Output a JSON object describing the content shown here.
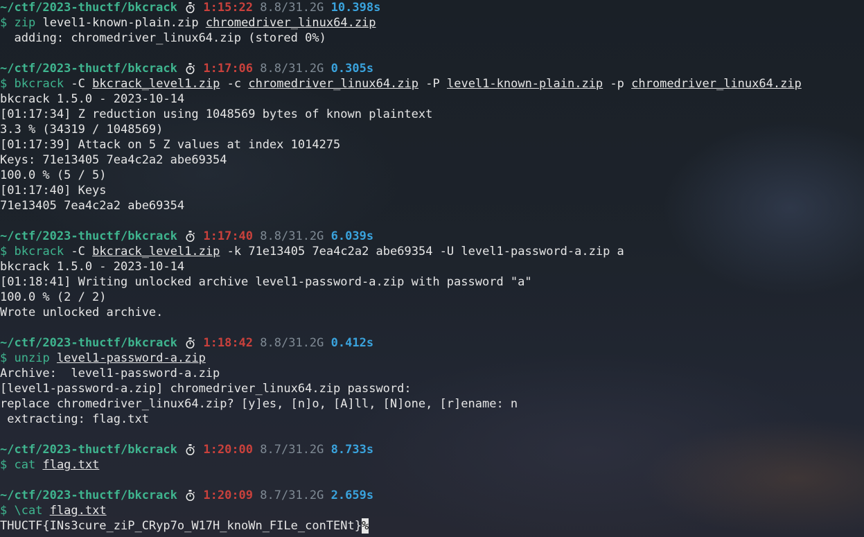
{
  "terminal": {
    "blocks": [
      {
        "prompt": {
          "path": "~/ctf/2023-thuctf/bkcrack",
          "icon": "stopwatch-icon",
          "time": "1:15:22",
          "mem": "8.8/31.2G",
          "duration": "10.398s"
        },
        "command": {
          "dollar": "$",
          "name": "zip",
          "args": [
            {
              "text": "level1-known-plain.zip",
              "underline": false
            },
            {
              "text": "chromedriver_linux64.zip",
              "underline": true
            }
          ]
        },
        "output": [
          "  adding: chromedriver_linux64.zip (stored 0%)"
        ]
      },
      {
        "prompt": {
          "path": "~/ctf/2023-thuctf/bkcrack",
          "icon": "stopwatch-icon",
          "time": "1:17:06",
          "mem": "8.8/31.2G",
          "duration": "0.305s"
        },
        "command": {
          "dollar": "$",
          "name": "bkcrack",
          "args": [
            {
              "text": "-C",
              "underline": false
            },
            {
              "text": "bkcrack_level1.zip",
              "underline": true
            },
            {
              "text": "-c",
              "underline": false
            },
            {
              "text": "chromedriver_linux64.zip",
              "underline": true
            },
            {
              "text": "-P",
              "underline": false
            },
            {
              "text": "level1-known-plain.zip",
              "underline": true
            },
            {
              "text": "-p",
              "underline": false
            },
            {
              "text": "chromedriver_linux64.zip",
              "underline": true
            }
          ]
        },
        "output": [
          "bkcrack 1.5.0 - 2023-10-14",
          "[01:17:34] Z reduction using 1048569 bytes of known plaintext",
          "3.3 % (34319 / 1048569)",
          "[01:17:39] Attack on 5 Z values at index 1014275",
          "Keys: 71e13405 7ea4c2a2 abe69354",
          "100.0 % (5 / 5)",
          "[01:17:40] Keys",
          "71e13405 7ea4c2a2 abe69354"
        ]
      },
      {
        "prompt": {
          "path": "~/ctf/2023-thuctf/bkcrack",
          "icon": "stopwatch-icon",
          "time": "1:17:40",
          "mem": "8.8/31.2G",
          "duration": "6.039s"
        },
        "command": {
          "dollar": "$",
          "name": "bkcrack",
          "args": [
            {
              "text": "-C",
              "underline": false
            },
            {
              "text": "bkcrack_level1.zip",
              "underline": true
            },
            {
              "text": "-k 71e13405 7ea4c2a2 abe69354 -U level1-password-a.zip a",
              "underline": false
            }
          ]
        },
        "output": [
          "bkcrack 1.5.0 - 2023-10-14",
          "[01:18:41] Writing unlocked archive level1-password-a.zip with password \"a\"",
          "100.0 % (2 / 2)",
          "Wrote unlocked archive."
        ]
      },
      {
        "prompt": {
          "path": "~/ctf/2023-thuctf/bkcrack",
          "icon": "stopwatch-icon",
          "time": "1:18:42",
          "mem": "8.8/31.2G",
          "duration": "0.412s"
        },
        "command": {
          "dollar": "$",
          "name": "unzip",
          "args": [
            {
              "text": "level1-password-a.zip",
              "underline": true
            }
          ]
        },
        "output": [
          "Archive:  level1-password-a.zip",
          "[level1-password-a.zip] chromedriver_linux64.zip password:",
          "replace chromedriver_linux64.zip? [y]es, [n]o, [A]ll, [N]one, [r]ename: n",
          " extracting: flag.txt"
        ]
      },
      {
        "prompt": {
          "path": "~/ctf/2023-thuctf/bkcrack",
          "icon": "stopwatch-icon",
          "time": "1:20:00",
          "mem": "8.7/31.2G",
          "duration": "8.733s"
        },
        "command": {
          "dollar": "$",
          "name": "cat",
          "args": [
            {
              "text": "flag.txt",
              "underline": true
            }
          ]
        },
        "output": []
      },
      {
        "prompt": {
          "path": "~/ctf/2023-thuctf/bkcrack",
          "icon": "stopwatch-icon",
          "time": "1:20:09",
          "mem": "8.7/31.2G",
          "duration": "2.659s"
        },
        "command": {
          "dollar": "$",
          "name": "\\cat",
          "args": [
            {
              "text": "flag.txt",
              "underline": true
            }
          ]
        },
        "output": [
          "THUCTF{INs3cure_ziP_CRyp7o_W17H_knoWn_FILe_conTENt}"
        ],
        "cursor": "%"
      }
    ]
  }
}
